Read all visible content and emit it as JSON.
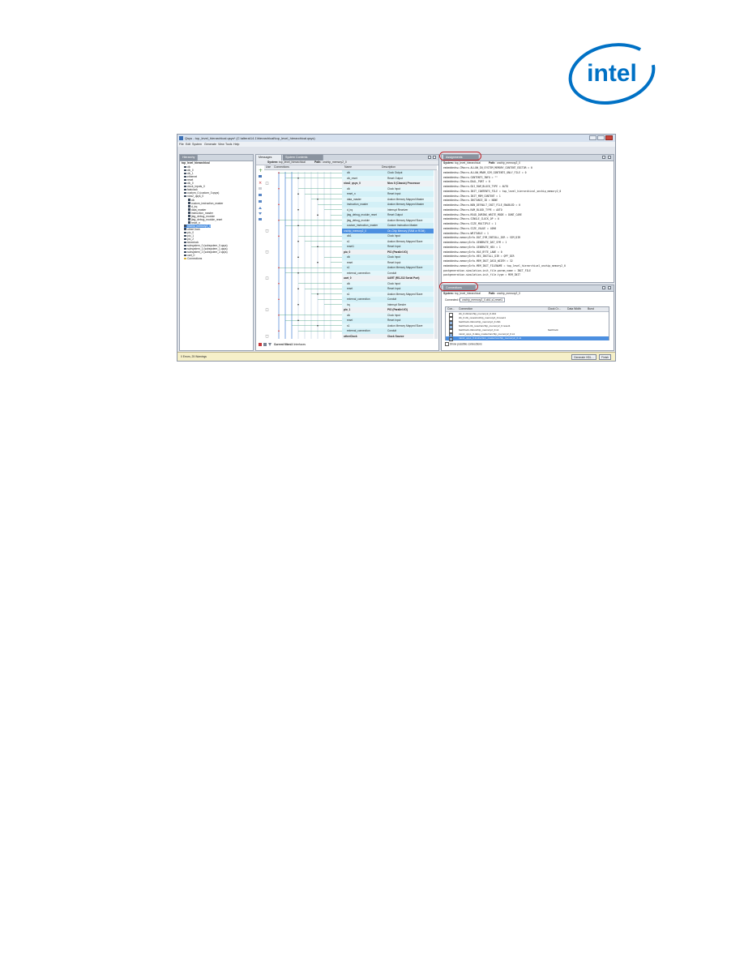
{
  "brand": {
    "logo_text": "intel",
    "color": "#0071c5"
  },
  "window": {
    "title": "Qsys - top_level_hierarchical.qsys* (C:\\altera\\14.1\\hierarchical\\top_level_hierarchical.qsys)",
    "menu": [
      "File",
      "Edit",
      "System",
      "Generate",
      "View",
      "Tools",
      "Help"
    ]
  },
  "hierarchy": {
    "tab": "Hierarchy",
    "root": "top_level_hierarchical",
    "items": [
      "clk",
      "clk_0",
      "clk_1",
      "ethernet",
      "reset",
      "clk_0",
      "clock_inputs_0",
      "fastclock",
      "custom_0 (custom_0.qsys)",
      "nios2_qsys_0",
      "clk",
      "custom_instruction_master",
      "d_irq",
      "data_master",
      "instruction_master",
      "jtag_debug_module",
      "jtag_debug_module_reset",
      "reset_n",
      "onchip_memory2_0",
      "otherClock",
      "pio_0",
      "pio_1",
      "pio_2",
      "slowclock",
      "subsystem_0 (subsystem_0.qsys)",
      "subsystem_1 (subsystem_1.qsys)",
      "subsystem_2 (subsystem_2.qsys)",
      "uart_0",
      "Connections"
    ],
    "selected_index": 18
  },
  "system_contents": {
    "tabs": [
      "Messages",
      "System Contents"
    ],
    "system_label": "System:",
    "system_name": "top_level_hierarchical",
    "path_label": "Path:",
    "path_value": "onchip_memory2_0",
    "col_use": "Use",
    "col_connections": "Connections",
    "col_name": "Name",
    "col_description": "Description",
    "rows": [
      {
        "name": "clk",
        "desc": "Clock Output",
        "kind": "port"
      },
      {
        "name": "clk_reset",
        "desc": "Reset Output",
        "kind": "port"
      },
      {
        "name": "nios2_qsys_0",
        "desc": "Nios II (Classic) Processor",
        "kind": "module"
      },
      {
        "name": "clk",
        "desc": "Clock Input",
        "kind": "port"
      },
      {
        "name": "reset_n",
        "desc": "Reset Input",
        "kind": "port"
      },
      {
        "name": "data_master",
        "desc": "Avalon Memory Mapped Master",
        "kind": "port"
      },
      {
        "name": "instruction_master",
        "desc": "Avalon Memory Mapped Master",
        "kind": "port"
      },
      {
        "name": "d_irq",
        "desc": "Interrupt Receiver",
        "kind": "port"
      },
      {
        "name": "jtag_debug_module_reset",
        "desc": "Reset Output",
        "kind": "port"
      },
      {
        "name": "jtag_debug_module",
        "desc": "Avalon Memory Mapped Slave",
        "kind": "port"
      },
      {
        "name": "custom_instruction_master",
        "desc": "Custom Instruction Master",
        "kind": "port"
      },
      {
        "name": "onchip_memory2_0",
        "desc": "On-Chip Memory (RAM or ROM)",
        "kind": "selected"
      },
      {
        "name": "clk1",
        "desc": "Clock Input",
        "kind": "port"
      },
      {
        "name": "s1",
        "desc": "Avalon Memory Mapped Slave",
        "kind": "port"
      },
      {
        "name": "reset1",
        "desc": "Reset Input",
        "kind": "port"
      },
      {
        "name": "pio_0",
        "desc": "PIO (Parallel I/O)",
        "kind": "module"
      },
      {
        "name": "clk",
        "desc": "Clock Input",
        "kind": "port"
      },
      {
        "name": "reset",
        "desc": "Reset Input",
        "kind": "port"
      },
      {
        "name": "s1",
        "desc": "Avalon Memory Mapped Slave",
        "kind": "port"
      },
      {
        "name": "external_connection",
        "desc": "Conduit",
        "kind": "port"
      },
      {
        "name": "uart_0",
        "desc": "UART (RS-232 Serial Port)",
        "kind": "module"
      },
      {
        "name": "clk",
        "desc": "Clock Input",
        "kind": "port"
      },
      {
        "name": "reset",
        "desc": "Reset Input",
        "kind": "port"
      },
      {
        "name": "s1",
        "desc": "Avalon Memory Mapped Slave",
        "kind": "port"
      },
      {
        "name": "external_connection",
        "desc": "Conduit",
        "kind": "port"
      },
      {
        "name": "irq",
        "desc": "Interrupt Sender",
        "kind": "port"
      },
      {
        "name": "pio_1",
        "desc": "PIO (Parallel I/O)",
        "kind": "module"
      },
      {
        "name": "clk",
        "desc": "Clock Input",
        "kind": "port"
      },
      {
        "name": "reset",
        "desc": "Reset Input",
        "kind": "port"
      },
      {
        "name": "s1",
        "desc": "Avalon Memory Mapped Slave",
        "kind": "port"
      },
      {
        "name": "external_connection",
        "desc": "Conduit",
        "kind": "port"
      },
      {
        "name": "otherClock",
        "desc": "Clock Source",
        "kind": "module"
      }
    ],
    "filter_label": "Current filter:",
    "filter_value": "All Interfaces"
  },
  "assignments": {
    "tab": "Assignments",
    "system_label": "System:",
    "system_name": "top_level_hierarchical",
    "path_label": "Path:",
    "path_value": "onchip_memory2_0",
    "lines": [
      "embeddedsw.CMacro.ALLOW_IN_SYSTEM_MEMORY_CONTENT_EDITOR = 0",
      "embeddedsw.CMacro.ALLOW_MRAM_SIM_CONTENTS_ONLY_FILE = 0",
      "embeddedsw.CMacro.CONTENTS_INFO = \"\"",
      "embeddedsw.CMacro.DUAL_PORT = 0",
      "embeddedsw.CMacro.GUI_RAM_BLOCK_TYPE = AUTO",
      "embeddedsw.CMacro.INIT_CONTENTS_FILE = top_level_hierarchical_onchip_memory2_0",
      "embeddedsw.CMacro.INIT_MEM_CONTENT = 1",
      "embeddedsw.CMacro.INSTANCE_ID = NONE",
      "embeddedsw.CMacro.NON_DEFAULT_INIT_FILE_ENABLED = 0",
      "embeddedsw.CMacro.RAM_BLOCK_TYPE = AUTO",
      "embeddedsw.CMacro.READ_DURING_WRITE_MODE = DONT_CARE",
      "embeddedsw.CMacro.SINGLE_CLOCK_OP = 0",
      "embeddedsw.CMacro.SIZE_MULTIPLE = 1",
      "embeddedsw.CMacro.SIZE_VALUE = 4096",
      "embeddedsw.CMacro.WRITABLE = 1",
      "embeddedsw.memoryInfo.DAT_SYM_INSTALL_DIR = SIM_DIR",
      "embeddedsw.memoryInfo.GENERATE_DAT_SYM = 1",
      "embeddedsw.memoryInfo.GENERATE_HEX = 1",
      "embeddedsw.memoryInfo.HAS_BYTE_LANE = 0",
      "embeddedsw.memoryInfo.HEX_INSTALL_DIR = QPF_DIR",
      "embeddedsw.memoryInfo.MEM_INIT_DATA_WIDTH = 32",
      "embeddedsw.memoryInfo.MEM_INIT_FILENAME = top_level_hierarchical_onchip_memory2_0",
      "postgeneration.simulation.init_file.param_name = INIT_FILE",
      "postgeneration.simulation.init_file.type = MEM_INIT"
    ]
  },
  "connections": {
    "tab": "Connections",
    "system_label": "System:",
    "system_name": "top_level_hierarchical",
    "path_label": "Path:",
    "path_value": "onchip_memory2_0",
    "connected_to_label": "Connected to:",
    "connected_to_value": "onchip_memory2_0.clk1,s1,reset1",
    "columns": [
      "Con...",
      "Connection",
      "Clock Cr...",
      "Data Width",
      "Burst"
    ],
    "rows": [
      {
        "connection": "clk_0.clk/onchip_memory2_0.clk1",
        "clock": "",
        "checked": false
      },
      {
        "connection": "clk_0.clk_reset/onchip_memory2_0.reset1",
        "clock": "",
        "checked": false
      },
      {
        "connection": "fastClock.clk/onchip_memory2_0.clk1",
        "clock": "",
        "checked": true
      },
      {
        "connection": "fastClock.clk_reset/onchip_memory2_0.reset1",
        "clock": "",
        "checked": true
      },
      {
        "connection": "fastClock.clk/onchip_memory2_0.s1",
        "clock": "fastClock",
        "checked": false
      },
      {
        "connection": "nios2_qsys_0.data_master/onchip_memory2_0.s1",
        "clock": "",
        "checked": true
      },
      {
        "connection": "nios2_qsys_0.instruction_master/onchip_memory2_0.s1",
        "clock": "",
        "checked": true
      }
    ],
    "show_possible_label": "Show possible connections"
  },
  "status": {
    "text": "0 Errors, 25 Warnings",
    "generate_label": "Generate HDL...",
    "finish_label": "Finish"
  }
}
